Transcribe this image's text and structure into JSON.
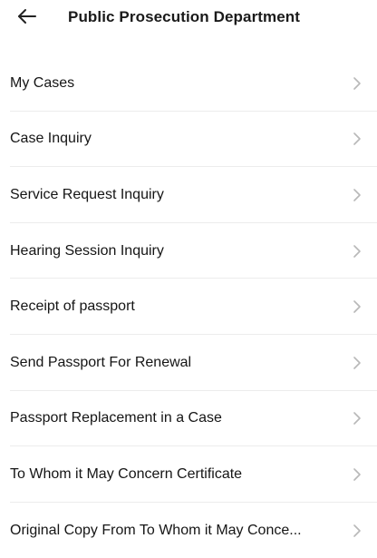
{
  "header": {
    "title": "Public Prosecution Department",
    "back_icon": "arrow-left-icon"
  },
  "colors": {
    "text": "#151515",
    "chevron": "#b8b8b8",
    "divider": "#ececec"
  },
  "menu": {
    "items": [
      {
        "label": "My Cases"
      },
      {
        "label": "Case Inquiry"
      },
      {
        "label": "Service Request Inquiry"
      },
      {
        "label": "Hearing Session Inquiry"
      },
      {
        "label": "Receipt of passport"
      },
      {
        "label": "Send Passport For Renewal"
      },
      {
        "label": "Passport Replacement in a Case"
      },
      {
        "label": "To Whom it May Concern Certificate"
      },
      {
        "label": "Original Copy From To Whom it May Conce..."
      }
    ],
    "item_icon": "chevron-right-icon"
  }
}
